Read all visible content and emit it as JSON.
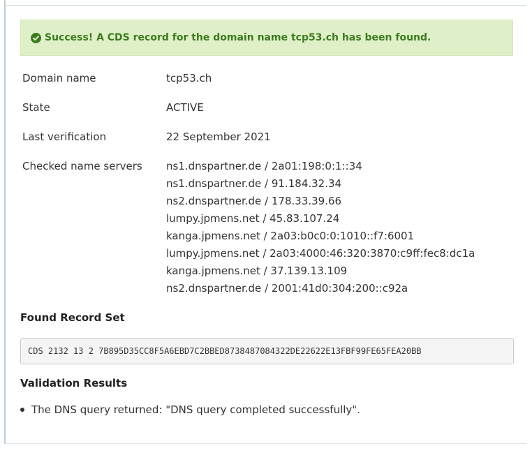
{
  "alert": {
    "message": "Success! A CDS record for the domain name tcp53.ch has been found."
  },
  "details": [
    {
      "label": "Domain name",
      "value": "tcp53.ch"
    },
    {
      "label": "State",
      "value": "ACTIVE"
    },
    {
      "label": "Last verification",
      "value": "22 September 2021"
    }
  ],
  "name_servers": {
    "label": "Checked name servers",
    "items": [
      "ns1.dnspartner.de / 2a01:198:0:1::34",
      "ns1.dnspartner.de / 91.184.32.34",
      "ns2.dnspartner.de / 178.33.39.66",
      "lumpy.jpmens.net / 45.83.107.24",
      "kanga.jpmens.net / 2a03:b0c0:0:1010::f7:6001",
      "lumpy.jpmens.net / 2a03:4000:46:320:3870:c9ff:fec8:dc1a",
      "kanga.jpmens.net / 37.139.13.109",
      "ns2.dnspartner.de / 2001:41d0:304:200::c92a"
    ]
  },
  "found_record_set": {
    "title": "Found Record Set",
    "record": "CDS 2132 13 2 7B895D35CC8F5A6EBD7C2BBED8738487084322DE22622E13FBF99FE65FEA20BB"
  },
  "validation": {
    "title": "Validation Results",
    "items": [
      "The DNS query returned: \"DNS query completed successfully\"."
    ]
  },
  "colors": {
    "success_bg": "#dff0c8",
    "success_text": "#3c7a1f"
  },
  "icons": {
    "alert_icon": "check-circle-icon"
  }
}
